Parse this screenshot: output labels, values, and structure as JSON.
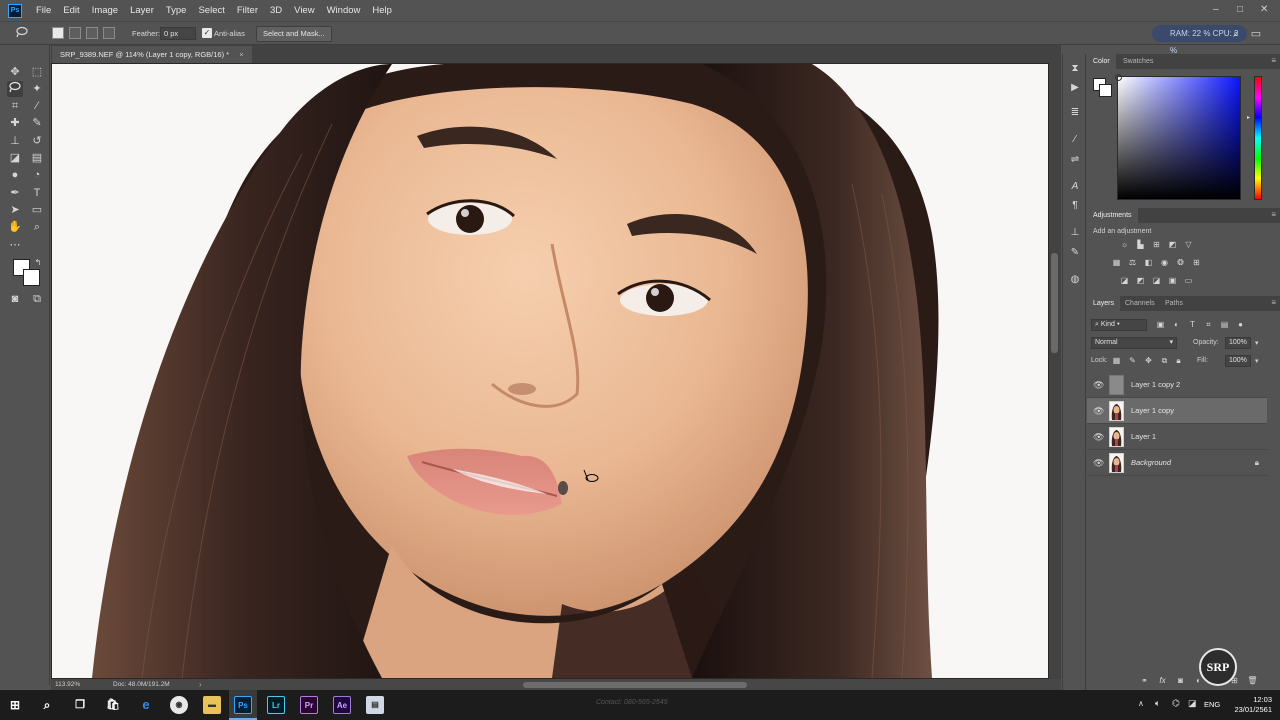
{
  "app": {
    "logo_text": "Ps",
    "menu": [
      "File",
      "Edit",
      "Image",
      "Layer",
      "Type",
      "Select",
      "Filter",
      "3D",
      "View",
      "Window",
      "Help"
    ],
    "window_controls": [
      "–",
      "□",
      "✕"
    ]
  },
  "options_bar": {
    "feather_label": "Feather:",
    "feather_value": "0 px",
    "antialias_label": "Anti-alias",
    "select_mask_label": "Select and Mask...",
    "ram_cpu": "RAM: 22 %  CPU: 2 %"
  },
  "document": {
    "tab_title": "SRP_9389.NEF @ 114% (Layer 1 copy, RGB/16) *",
    "tab_close": "×",
    "zoom": "113.92%",
    "doc_size": "Doc: 48.0M/191.2M"
  },
  "color_panel": {
    "tabs": [
      "Color",
      "Swatches"
    ],
    "foreground": "#ffffff",
    "background": "#ffffff"
  },
  "adjustments_panel": {
    "title": "Adjustments",
    "subtitle": "Add an adjustment"
  },
  "layers_panel": {
    "tabs": [
      "Layers",
      "Channels",
      "Paths"
    ],
    "filter_kind": "Kind",
    "blend_mode": "Normal",
    "opacity_label": "Opacity:",
    "opacity_value": "100%",
    "lock_label": "Lock:",
    "fill_label": "Fill:",
    "fill_value": "100%",
    "layers": [
      {
        "name": "Layer 1 copy 2",
        "selected": false,
        "thumb": "gray"
      },
      {
        "name": "Layer 1 copy",
        "selected": true,
        "thumb": "portrait"
      },
      {
        "name": "Layer 1",
        "selected": false,
        "thumb": "portrait"
      },
      {
        "name": "Background",
        "selected": false,
        "thumb": "portrait",
        "locked": true
      }
    ],
    "footer_icons": [
      "link-icon",
      "fx-icon",
      "mask-icon",
      "adjustment-icon",
      "group-icon",
      "new-layer-icon",
      "trash-icon"
    ]
  },
  "watermark": {
    "logo_text": "SRP",
    "contact": "Contact: 080-565-2545"
  },
  "taskbar": {
    "apps": [
      "Ps",
      "Lr",
      "Pr",
      "Ae"
    ],
    "language": "ENG",
    "time": "12:03",
    "date": "23/01/2561"
  }
}
